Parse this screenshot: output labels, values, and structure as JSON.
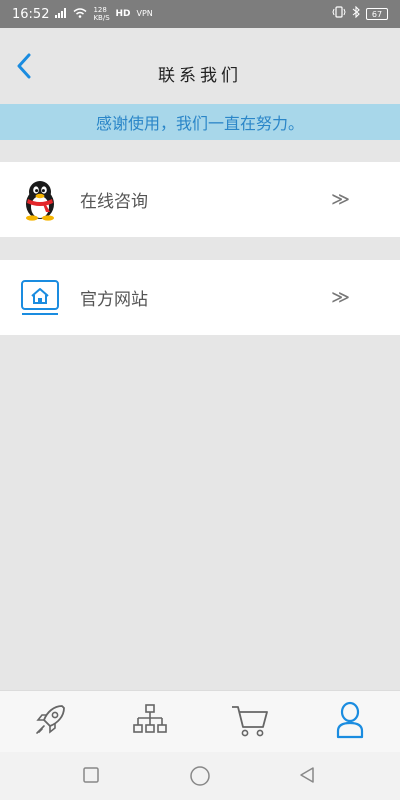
{
  "status_bar": {
    "time": "16:52",
    "network_speed": "128 KB/S",
    "hd_label": "HD",
    "vpn_label": "VPN",
    "battery": "67"
  },
  "header": {
    "title": "联系我们",
    "back_icon": "chevron-left-icon"
  },
  "notice": {
    "text": "感谢使用，我们一直在努力。"
  },
  "contact_items": [
    {
      "icon": "qq-penguin-icon",
      "label": "在线咨询",
      "arrow": "≫"
    },
    {
      "icon": "home-website-icon",
      "label": "官方网站",
      "arrow": "≫"
    }
  ],
  "tab_bar": {
    "items": [
      {
        "icon": "rocket-icon",
        "active": false
      },
      {
        "icon": "sitemap-icon",
        "active": false
      },
      {
        "icon": "cart-icon",
        "active": false
      },
      {
        "icon": "user-icon",
        "active": true
      }
    ],
    "active_color": "#1a8ce0",
    "inactive_color": "#666666"
  },
  "colors": {
    "accent": "#1a8ce0",
    "banner_bg": "#a8d7ea",
    "banner_text": "#2b86c8",
    "page_bg": "#e6e6e6"
  }
}
